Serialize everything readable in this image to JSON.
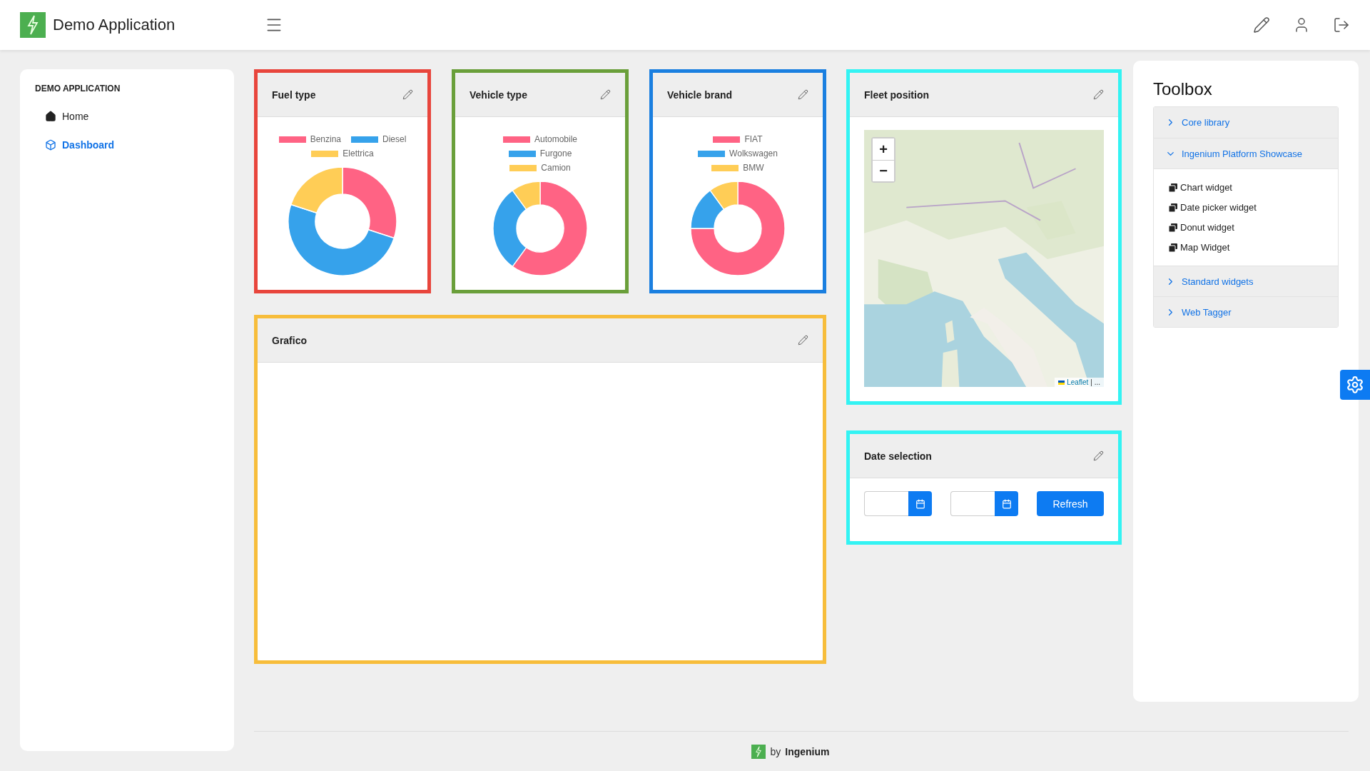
{
  "header": {
    "title": "Demo Application"
  },
  "sidebar": {
    "title": "DEMO APPLICATION",
    "items": [
      {
        "label": "Home",
        "selected": false
      },
      {
        "label": "Dashboard",
        "selected": true
      }
    ]
  },
  "donut_widgets": [
    {
      "title": "Fuel type",
      "color": "#e8453c",
      "legend": [
        {
          "label": "Benzina",
          "color": "#ff6384"
        },
        {
          "label": "Diesel",
          "color": "#36a2eb"
        },
        {
          "label": "Elettrica",
          "color": "#ffcd56"
        }
      ]
    },
    {
      "title": "Vehicle type",
      "color": "#6a9f3a",
      "legend": [
        {
          "label": "Automobile",
          "color": "#ff6384"
        },
        {
          "label": "Furgone",
          "color": "#36a2eb"
        },
        {
          "label": "Camion",
          "color": "#ffcd56"
        }
      ]
    },
    {
      "title": "Vehicle brand",
      "color": "#1a7fe0",
      "legend": [
        {
          "label": "FIAT",
          "color": "#ff6384"
        },
        {
          "label": "Wolkswagen",
          "color": "#36a2eb"
        },
        {
          "label": "BMW",
          "color": "#ffcd56"
        }
      ]
    }
  ],
  "map_widget": {
    "title": "Fleet position",
    "color": "#33f3f3",
    "zoom_in": "+",
    "zoom_out": "−",
    "attribution": "Leaflet",
    "attribution_more": "| ..."
  },
  "chart_widget": {
    "title": "Grafico",
    "color": "#f7bd3b"
  },
  "date_widget": {
    "title": "Date selection",
    "color": "#33f3f3",
    "fields": [
      {
        "kind": "date"
      },
      {
        "kind": "date"
      }
    ],
    "button": "Refresh"
  },
  "toolbox": {
    "title": "Toolbox",
    "sections": [
      {
        "label": "Core library",
        "expanded": false
      },
      {
        "label": "Ingenium Platform Showcase",
        "expanded": true,
        "children": [
          {
            "label": "Chart widget"
          },
          {
            "label": "Date picker widget"
          },
          {
            "label": "Donut widget"
          },
          {
            "label": "Map Widget"
          }
        ]
      },
      {
        "label": "Standard widgets",
        "expanded": false
      },
      {
        "label": "Web Tagger",
        "expanded": false
      }
    ]
  },
  "footer": {
    "by": "by",
    "brand": "Ingenium"
  }
}
